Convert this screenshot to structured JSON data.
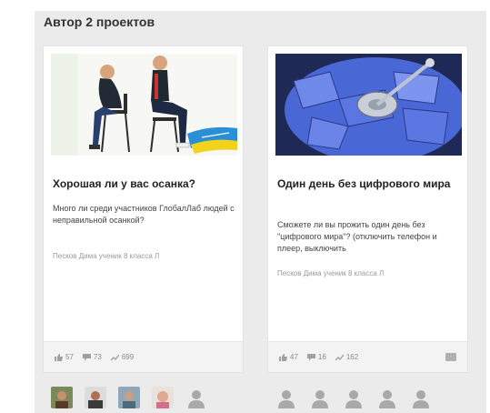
{
  "section": {
    "title": "Автор 2 проектов"
  },
  "cards": [
    {
      "title": "Хорошая ли у вас осанка?",
      "description": "Много ли среди участников ГлобалЛаб людей с неправильной осанкой?",
      "author": "Песков Дима ученик 8 класса Л",
      "stats": {
        "likes": "57",
        "comments": "73",
        "views": "699"
      },
      "image_icon": "posture-photo",
      "avatars": [
        "avatar-photo-1",
        "avatar-photo-2",
        "avatar-photo-3",
        "avatar-photo-4",
        "avatar-placeholder"
      ]
    },
    {
      "title": "Один день без цифрового мира",
      "description": "Сможете ли вы прожить один день без \"цифрового мира\"? (отключить телефон и плеер, выключить",
      "author": "Песков Дима ученик 8 класса Л",
      "stats": {
        "likes": "47",
        "comments": "16",
        "views": "162"
      },
      "image_icon": "broken-disk-photo",
      "avatars": [
        "avatar-placeholder",
        "avatar-placeholder",
        "avatar-placeholder",
        "avatar-placeholder",
        "avatar-placeholder"
      ]
    }
  ],
  "colors": {
    "section_bg": "#ebebeb",
    "card_bg": "#ffffff",
    "stats_bg": "#f3f3f3",
    "muted_text": "#9a9a9a",
    "disk_blue": "#4a67d6"
  }
}
